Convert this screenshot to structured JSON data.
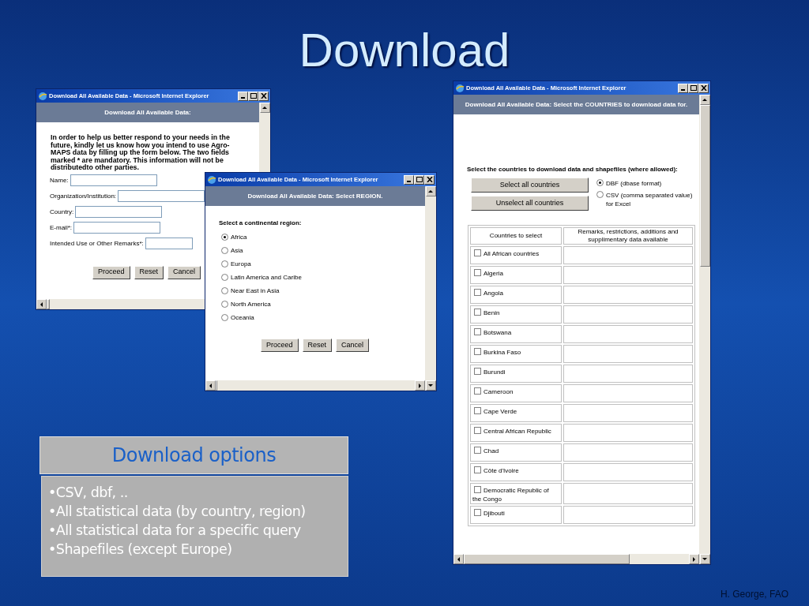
{
  "title": "Download",
  "windows": [
    {
      "kind": "form",
      "title": "Download All Available Data - Microsoft Internet Explorer",
      "header": "Download All Available Data:",
      "intro": "In order to help us better respond to your needs in the future, kindly let us know how you intend to use Agro-MAPS data by filling up the form below. The two fields marked * are mandatory. This information will not be distributedto other parties.",
      "fields": [
        {
          "label": "Name:"
        },
        {
          "label": "Organization/Institution:"
        },
        {
          "label": "Country:"
        },
        {
          "label": "E-mail*:"
        },
        {
          "label": "Intended Use or Other Remarks*:"
        }
      ],
      "buttons": [
        "Proceed",
        "Reset",
        "Cancel"
      ]
    },
    {
      "kind": "region",
      "title": "Download All Available Data - Microsoft Internet Explorer",
      "header": "Download All Available Data:  Select REGION.",
      "prompt": "Select a continental region:",
      "options": [
        {
          "label": "Africa",
          "selected": true
        },
        {
          "label": "Asia",
          "selected": false
        },
        {
          "label": "Europa",
          "selected": false
        },
        {
          "label": "Latin America and Caribe",
          "selected": false
        },
        {
          "label": "Near East in Asia",
          "selected": false
        },
        {
          "label": "North America",
          "selected": false
        },
        {
          "label": "Oceania",
          "selected": false
        }
      ],
      "buttons": [
        "Proceed",
        "Reset",
        "Cancel"
      ]
    },
    {
      "kind": "countries",
      "title": "Download All Available Data - Microsoft Internet Explorer",
      "header": "Download All Available Data:  Select the COUNTRIES to download data for.",
      "prompt": "Select the countries to download data and shapefiles (where allowed):",
      "buttons": [
        "Select all countries",
        "Unselect all countries"
      ],
      "formats": [
        {
          "label": "DBF (dbase format)",
          "selected": true
        },
        {
          "label": "CSV (comma separated value) for Excel",
          "selected": false
        }
      ],
      "columns": [
        "Countries to select",
        "Remarks, restrictions, additions and supplimentary data available"
      ],
      "rows": [
        {
          "label": "All African countries",
          "checked": false
        },
        {
          "label": "Algeria",
          "checked": false
        },
        {
          "label": "Angola",
          "checked": false
        },
        {
          "label": "Benin",
          "checked": false
        },
        {
          "label": "Botswana",
          "checked": false
        },
        {
          "label": "Burkina Faso",
          "checked": false
        },
        {
          "label": "Burundi",
          "checked": false
        },
        {
          "label": "Cameroon",
          "checked": false
        },
        {
          "label": "Cape Verde",
          "checked": false
        },
        {
          "label": "Central African Republic",
          "checked": false
        },
        {
          "label": "Chad",
          "checked": false
        },
        {
          "label": "Côte d'Ivoire",
          "checked": false
        },
        {
          "label": "Democratic Republic of the Congo",
          "checked": false
        },
        {
          "label": "Djibouti",
          "checked": false
        }
      ]
    }
  ],
  "options_box": {
    "heading": "Download options",
    "items": [
      "•CSV, dbf, ..",
      "•All statistical data (by country, region)",
      "•All statistical data for a specific query",
      "•Shapefiles (except Europe)"
    ]
  },
  "footer": "H. George, FAO"
}
